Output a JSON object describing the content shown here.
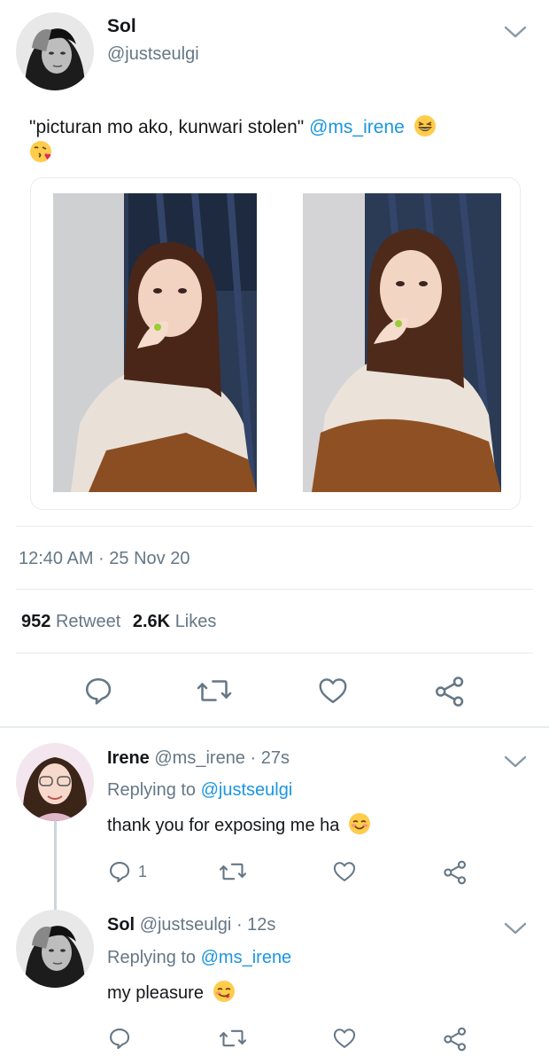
{
  "tweet": {
    "display_name": "Sol",
    "handle": "@justseulgi",
    "text": "\"picturan mo ako, kunwari stolen\"",
    "mention": "@ms_irene",
    "timestamp": "12:40 AM · 25 Nov 20",
    "stats": {
      "retweets_count": "952",
      "retweets_label": "Retweet",
      "likes_count": "2.6K",
      "likes_label": "Likes"
    },
    "emojis": [
      "grinning-squinting-emoji",
      "face-blowing-kiss-emoji"
    ]
  },
  "replies": [
    {
      "display_name": "Irene",
      "handle": "@ms_irene",
      "time": "· 27s",
      "replying_prefix": "Replying to",
      "replying_to": "@justseulgi",
      "text": "thank you for exposing me ha",
      "reply_count": "1",
      "emoji": "smiling-blushing-emoji"
    },
    {
      "display_name": "Sol",
      "handle": "@justseulgi",
      "time": "· 12s",
      "replying_prefix": "Replying to",
      "replying_to": "@ms_irene",
      "text": "my pleasure",
      "reply_count": "",
      "emoji": "yum-face-emoji"
    }
  ],
  "colors": {
    "link": "#1b95e0",
    "secondary_text": "#657786",
    "divider": "#e6ecf0",
    "icon": "#657786"
  }
}
